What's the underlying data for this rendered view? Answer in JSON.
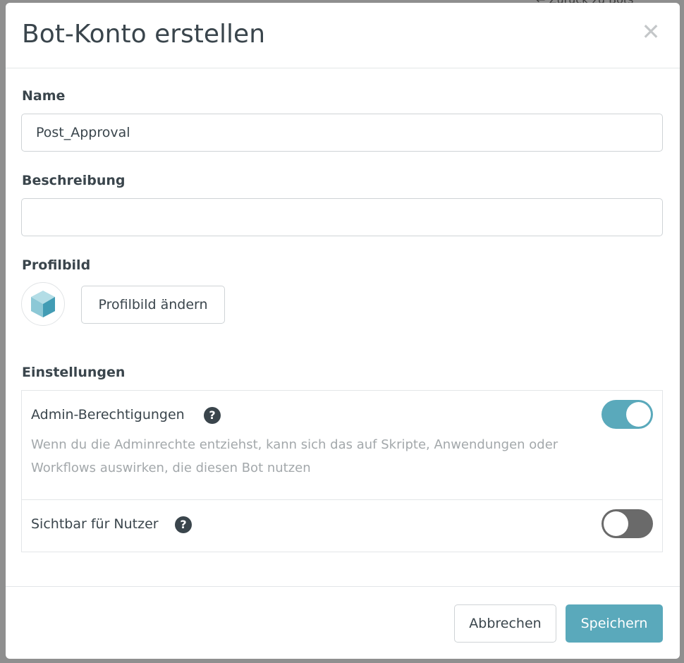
{
  "backdrop": {
    "top_right_text": "← Zurück zu Bots"
  },
  "modal": {
    "title": "Bot-Konto erstellen",
    "close_icon": "close-icon"
  },
  "form": {
    "name": {
      "label": "Name",
      "value": "Post_Approval",
      "placeholder": ""
    },
    "description": {
      "label": "Beschreibung",
      "value": "",
      "placeholder": ""
    },
    "profile_image": {
      "label": "Profilbild",
      "change_button": "Profilbild ändern",
      "avatar_icon": "cube-icon"
    },
    "settings": {
      "label": "Einstellungen",
      "admin": {
        "label": "Admin-Berechtigungen",
        "description": "Wenn du die Adminrechte entziehst, kann sich das auf Skripte, Anwendungen oder Workflows auswirken, die diesen Bot nutzen",
        "enabled": true
      },
      "visible": {
        "label": "Sichtbar für Nutzer",
        "enabled": false
      }
    }
  },
  "footer": {
    "cancel_label": "Abbrechen",
    "save_label": "Speichern"
  },
  "colors": {
    "accent": "#5aa9bb",
    "toggle_off": "#6a6a6a",
    "text": "#3a454c",
    "muted_text": "#a3a8ab"
  }
}
